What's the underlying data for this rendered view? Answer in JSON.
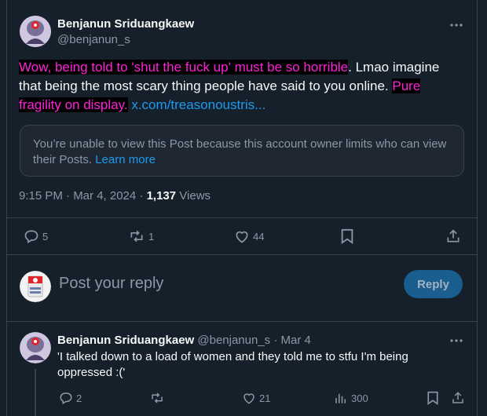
{
  "post": {
    "author_name": "Benjanun Sriduangkaew",
    "author_handle": "@benjanun_s",
    "text_highlight_1": "Wow, being told to 'shut the fuck up' must be so horrible",
    "text_plain": ". Lmao imagine that being the most scary thing people have said to you online. ",
    "text_highlight_2": "Pure fragility on display.",
    "link": "x.com/treasonoustris...",
    "notice_text": "You’re unable to view this Post because this account owner limits who can view their Posts.",
    "notice_link": "Learn more",
    "time": "9:15 PM · Mar 4, 2024 · ",
    "views_count": "1,137",
    "views_label": " Views",
    "actions": {
      "replies": "5",
      "reposts": "1",
      "likes": "44"
    }
  },
  "compose": {
    "placeholder": "Post your reply",
    "button_label": "Reply"
  },
  "reply": {
    "author_name": "Benjanun Sriduangkaew",
    "author_handle": "@benjanun_s · Mar 4",
    "text": "'I talked down to a load of women and they told me to stfu I'm being oppressed :('",
    "actions": {
      "replies": "2",
      "likes": "21",
      "views": "300"
    }
  },
  "colors": {
    "background": "#15202b",
    "highlight_text": "#ff21d9",
    "link": "#1d9bf0",
    "muted": "#8b98a5"
  }
}
